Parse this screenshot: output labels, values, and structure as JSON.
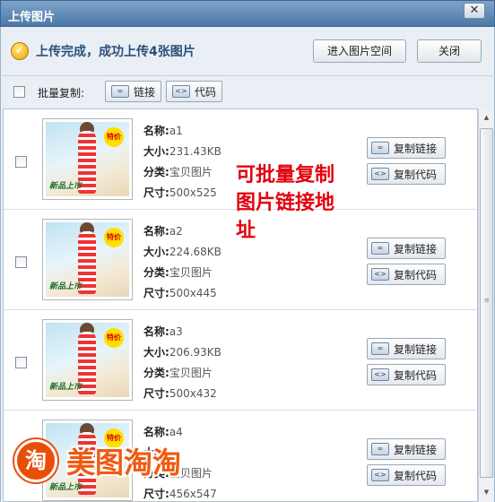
{
  "window": {
    "title": "上传图片",
    "close_glyph": "✕"
  },
  "status": {
    "icon": "check-icon",
    "message": "上传完成，成功上传4张图片"
  },
  "header_buttons": {
    "open_space": "进入图片空间",
    "close": "关闭"
  },
  "toolbar": {
    "batch_label": "批量复制:",
    "link_label": "链接",
    "code_label": "代码"
  },
  "labels": {
    "name": "名称:",
    "size": "大小:",
    "category": "分类:",
    "dimensions": "尺寸:"
  },
  "items": [
    {
      "name": "a1",
      "size": "231.43KB",
      "category": "宝贝图片",
      "dimensions": "500x525",
      "copy_link": "复制链接",
      "copy_code": "复制代码",
      "tag": "特价",
      "banner": "新品上市"
    },
    {
      "name": "a2",
      "size": "224.68KB",
      "category": "宝贝图片",
      "dimensions": "500x445",
      "copy_link": "复制链接",
      "copy_code": "复制代码",
      "tag": "特价",
      "banner": "新品上市"
    },
    {
      "name": "a3",
      "size": "206.93KB",
      "category": "宝贝图片",
      "dimensions": "500x432",
      "copy_link": "复制链接",
      "copy_code": "复制代码",
      "tag": "特价",
      "banner": "新品上市"
    },
    {
      "name": "a4",
      "size": "",
      "category": "宝贝图片",
      "dimensions": "456x547",
      "copy_link": "复制链接",
      "copy_code": "复制代码",
      "tag": "特价",
      "banner": "新品上市"
    }
  ],
  "annotation": "可批量复制图片链接地址",
  "watermark": {
    "logo_char": "淘",
    "text": "美图淘淘"
  },
  "colors": {
    "accent_red": "#e3000e",
    "brand_orange": "#f05a10",
    "title_blue": "#2b4f7a"
  }
}
